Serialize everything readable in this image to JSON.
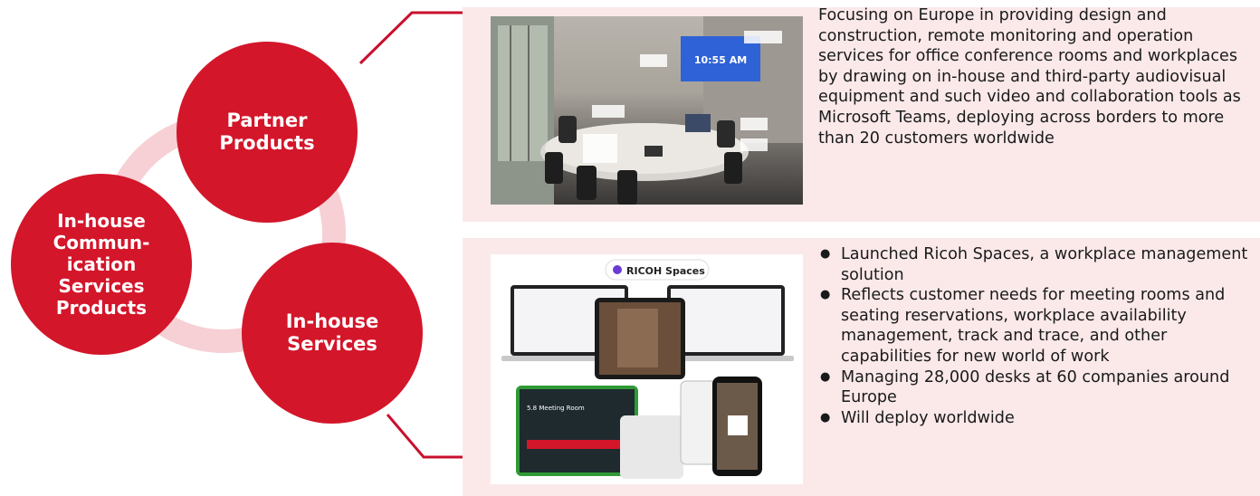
{
  "circles": {
    "partner": "Partner\nProducts",
    "inhouse_products": "In-house\nCommun-\nication\nServices\nProducts",
    "inhouse_services": "In-house\nServices"
  },
  "top_panel": {
    "photo_overlay_time": "10:55 AM",
    "description": "Focusing on Europe in providing design and construction, remote monitoring and operation services for office conference rooms and workplaces by drawing on in-house and third-party audiovisual equipment and such video and collaboration tools as Microsoft Teams, deploying across borders to more than 20 customers worldwide"
  },
  "bottom_panel": {
    "photo_badge": "RICOH Spaces",
    "photo_room_label": "5.8 Meeting Room",
    "bullets": [
      "Launched Ricoh Spaces, a workplace management solution",
      "Reflects customer needs for meeting rooms and seating reservations, workplace availability management, track and trace, and other capabilities for new world of work",
      "Managing 28,000 desks at 60 companies around Europe",
      "Will deploy worldwide"
    ]
  },
  "colors": {
    "accent": "#d3162a",
    "ring": "#f6d0d4",
    "panel_bg": "#fbe9ea"
  }
}
